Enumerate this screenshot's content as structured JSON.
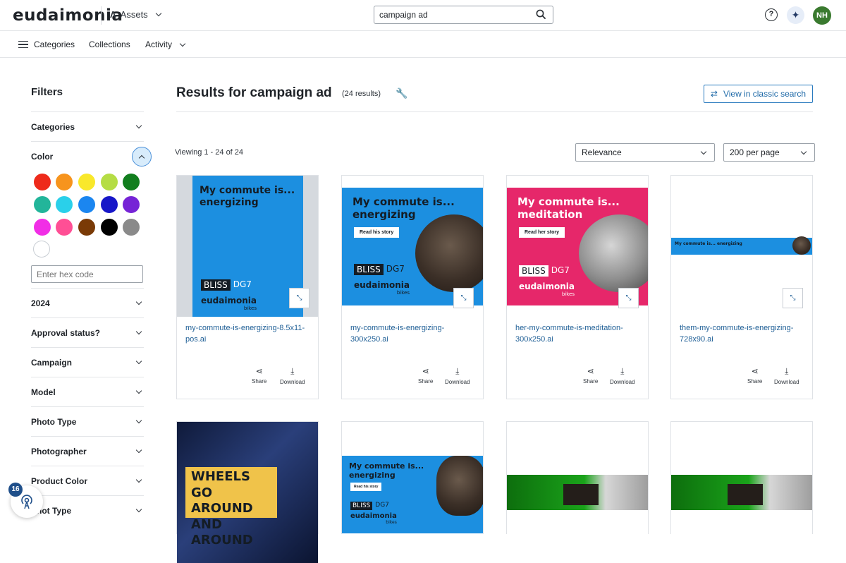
{
  "header": {
    "logo_text": "eudaimonia",
    "module_label": "Assets",
    "search_value": "campaign ad",
    "avatar_initials": "NH",
    "accent_color": "#1f6aa8"
  },
  "nav": {
    "categories_label": "Categories",
    "collections_label": "Collections",
    "activity_label": "Activity"
  },
  "filters": {
    "title": "Filters",
    "categories_label": "Categories",
    "color_label": "Color",
    "hex_placeholder": "Enter hex code",
    "swatches": [
      "#ee2a1b",
      "#f7941d",
      "#f9e82b",
      "#b5dd45",
      "#127e1e",
      "#22b59a",
      "#2ad0ea",
      "#1b86f0",
      "#1717c8",
      "#7624d6",
      "#f12ee6",
      "#ff4f95",
      "#7a3a06",
      "#000000",
      "#8a8a8a",
      "#ffffff"
    ],
    "groups": [
      "2024",
      "Approval status?",
      "Campaign",
      "Model",
      "Photo Type",
      "Photographer",
      "Product Color",
      "Shot Type"
    ]
  },
  "main": {
    "results_title": "Results for campaign ad",
    "results_count": "(24 results)",
    "classic_search_label": "View in classic search",
    "viewing_text": "Viewing 1 - 24 of 24",
    "sort_value": "Relevance",
    "per_page_value": "200 per page",
    "share_label": "Share",
    "download_label": "Download"
  },
  "cards": [
    {
      "name": "my-commute-is-energizing-8.5x11-pos.ai",
      "headline": "My commute is... energizing",
      "cta": "",
      "product": "BLISS",
      "model": "DG7",
      "brand": "eudaimonia",
      "sub": "bikes"
    },
    {
      "name": "my-commute-is-energizing-300x250.ai",
      "headline": "My commute is... energizing",
      "cta": "Read his story",
      "product": "BLISS",
      "model": "DG7",
      "brand": "eudaimonia",
      "sub": "bikes"
    },
    {
      "name": "her-my-commute-is-meditation-300x250.ai",
      "headline": "My commute is... meditation",
      "cta": "Read her story",
      "product": "BLISS",
      "model": "DG7",
      "brand": "eudaimonia",
      "sub": "bikes"
    },
    {
      "name": "them-my-commute-is-energizing-728x90.ai",
      "headline": "My commute is... energizing",
      "cta": "",
      "product": "",
      "model": "",
      "brand": "",
      "sub": ""
    },
    {
      "name": "",
      "headline": "WHEELS GO AROUND AND AROUND",
      "cta": "",
      "product": "",
      "model": "",
      "brand": "",
      "sub": ""
    },
    {
      "name": "",
      "headline": "My commute is... energizing",
      "cta": "Read his story",
      "product": "BLISS",
      "model": "DG7",
      "brand": "eudaimonia",
      "sub": "bikes"
    },
    {
      "name": "",
      "headline": "",
      "cta": "",
      "product": "",
      "model": "",
      "brand": "",
      "sub": ""
    },
    {
      "name": "",
      "headline": "",
      "cta": "",
      "product": "",
      "model": "",
      "brand": "",
      "sub": ""
    }
  ],
  "floating": {
    "notification_count": "16"
  }
}
